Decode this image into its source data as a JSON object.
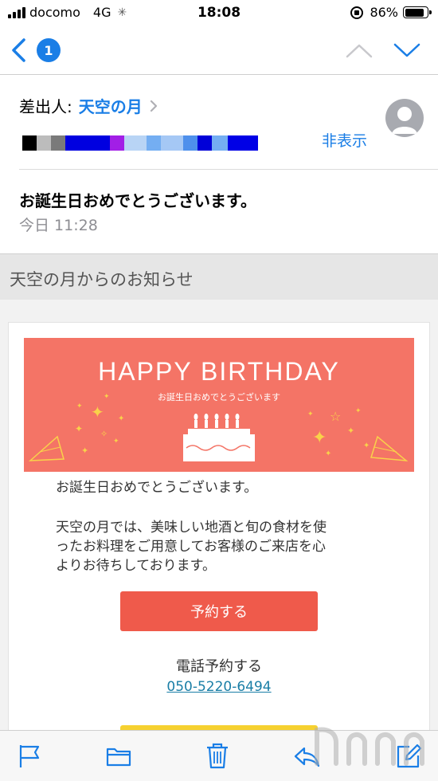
{
  "status_bar": {
    "carrier": "docomo",
    "network": "4G",
    "time": "18:08",
    "battery_percent": "86%",
    "battery_level": 0.86
  },
  "nav": {
    "unread_count": "1"
  },
  "header": {
    "sender_label": "差出人:",
    "sender_name": "天空の月",
    "hide_label": "非表示",
    "subject": "お誕生日おめでとうございます。",
    "date": "今日 11:28",
    "redaction_colors": [
      "#000000",
      "#bcbcbc",
      "#7a7a7a",
      "#0000e0",
      "#0000e0",
      "#a21fe6",
      "#b8d4f5",
      "#74aef2",
      "#a5c8f5",
      "#4e90ec",
      "#0000d8",
      "#74aef2",
      "#0000e6"
    ]
  },
  "section_title": "天空の月からのお知らせ",
  "banner": {
    "title": "HAPPY BIRTHDAY",
    "subtitle": "お誕生日おめでとうございます",
    "background": "#f47466"
  },
  "body": {
    "greeting": "お誕生日おめでとうございます。",
    "line1": "天空の月では、美味しい地酒と旬の食材を使",
    "line2": "ったお料理をご用意してお客様のご来店を心",
    "line3": "よりお待ちしております。"
  },
  "actions": {
    "reserve_button": "予約する",
    "phone_label": "電話予約する",
    "phone_number": "050-5220-6494"
  },
  "colors": {
    "accent": "#1a7ee6",
    "button": "#ef5a4b"
  },
  "toolbar": {
    "icons": [
      "flag-icon",
      "folder-icon",
      "trash-icon",
      "reply-icon",
      "compose-icon"
    ]
  }
}
